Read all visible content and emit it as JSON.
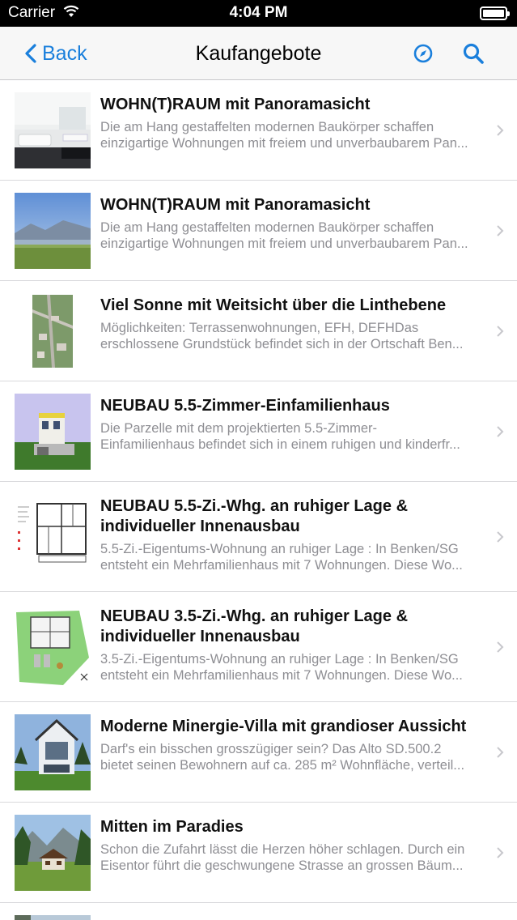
{
  "status_bar": {
    "carrier": "Carrier",
    "time": "4:04 PM"
  },
  "nav": {
    "back_label": "Back",
    "title": "Kaufangebote",
    "accent_color": "#1a7fdc",
    "icons": [
      "chevron-left-icon",
      "compass-icon",
      "search-icon"
    ]
  },
  "listings": [
    {
      "title_lines": [
        "WOHN(T)RAUM mit Panoramasicht"
      ],
      "desc_lines": [
        "Die am Hang gestaffelten modernen Baukörper schaffen",
        "einzigartige Wohnungen mit freiem und unverbaubarem Pan..."
      ],
      "thumb": "bathroom-photo"
    },
    {
      "title_lines": [
        "WOHN(T)RAUM mit Panoramasicht"
      ],
      "desc_lines": [
        "Die am Hang gestaffelten modernen Baukörper schaffen",
        "einzigartige Wohnungen mit freiem und unverbaubarem Pan..."
      ],
      "thumb": "terrace-view-photo"
    },
    {
      "title_lines": [
        "Viel Sonne mit Weitsicht über die Linthebene"
      ],
      "desc_lines": [
        "Möglichkeiten: Terrassenwohnungen, EFH, DEFHDas",
        "erschlossene Grundstück befindet sich in der Ortschaft Ben..."
      ],
      "thumb": "aerial-map-photo"
    },
    {
      "title_lines": [
        "NEUBAU 5.5-Zimmer-Einfamilienhaus"
      ],
      "desc_lines": [
        "Die Parzelle mit dem projektierten 5.5-Zimmer-",
        "Einfamilienhaus befindet sich in einem ruhigen und kinderfr..."
      ],
      "thumb": "house-render-photo"
    },
    {
      "title_lines": [
        "NEUBAU 5.5-Zi.-Whg. an ruhiger Lage &",
        "individueller Innenausbau"
      ],
      "desc_lines": [
        "5.5-Zi.-Eigentums-Wohnung an ruhiger Lage : In Benken/SG",
        "entsteht ein Mehrfamilienhaus mit 7 Wohnungen. Diese Wo..."
      ],
      "thumb": "floor-plan"
    },
    {
      "title_lines": [
        "NEUBAU 3.5-Zi.-Whg. an ruhiger Lage &",
        "individueller Innenausbau"
      ],
      "desc_lines": [
        "3.5-Zi.-Eigentums-Wohnung an ruhiger Lage : In Benken/SG",
        "entsteht ein Mehrfamilienhaus mit 7 Wohnungen. Diese Wo..."
      ],
      "thumb": "site-plan"
    },
    {
      "title_lines": [
        "Moderne Minergie-Villa mit grandioser Aussicht"
      ],
      "desc_lines": [
        "Darf's ein bisschen grosszügiger sein? Das Alto SD.500.2",
        "bietet seinen Bewohnern auf ca. 285 m² Wohnfläche, verteil..."
      ],
      "thumb": "villa-photo"
    },
    {
      "title_lines": [
        "Mitten im Paradies"
      ],
      "desc_lines": [
        "Schon die Zufahrt lässt die Herzen höher schlagen. Durch ein",
        "Eisentor führt die geschwungene Strasse an grossen Bäum..."
      ],
      "thumb": "chalet-photo"
    }
  ]
}
